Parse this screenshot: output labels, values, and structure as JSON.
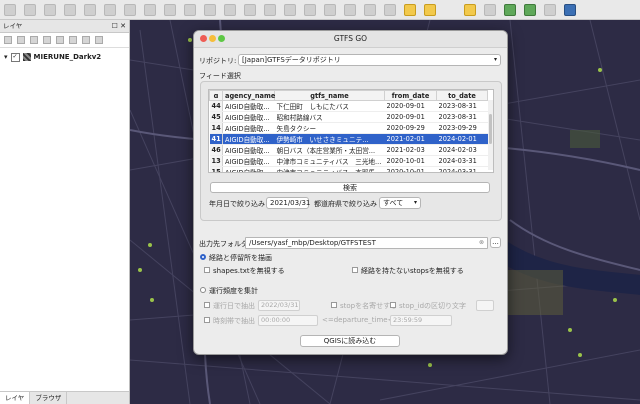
{
  "layers_panel": {
    "title": "レイヤ",
    "layer_name": "MIERUNE_Darkv2",
    "layer_checked": "✓",
    "tabs": [
      "レイヤ",
      "ブラウザ"
    ]
  },
  "dialog": {
    "title": "GTFS GO",
    "repo_label": "リポジトリ:",
    "repo_value": "[Japan]GTFSデータリポジトリ",
    "feed_group_label": "フィード選択",
    "columns": [
      "agency_name",
      "gtfs_name",
      "from_date",
      "to_date"
    ],
    "rows": [
      {
        "id": "44",
        "agency": "AIGID自動取...",
        "gtfs": "下仁田町　しもにたバス",
        "from": "2020-09-01",
        "to": "2023-08-31"
      },
      {
        "id": "45",
        "agency": "AIGID自動取...",
        "gtfs": "昭和村路線バス",
        "from": "2020-09-01",
        "to": "2023-08-31"
      },
      {
        "id": "14",
        "agency": "AIGID自動取...",
        "gtfs": "矢島タクシー",
        "from": "2020-09-29",
        "to": "2023-09-29"
      },
      {
        "id": "41",
        "agency": "AIGID自動取...",
        "gtfs": "伊勢崎市　いせさきミュニテ...",
        "from": "2021-02-01",
        "to": "2024-02-01"
      },
      {
        "id": "46",
        "agency": "AIGID自動取...",
        "gtfs": "朝日バス（本庄営業所・太田営...",
        "from": "2021-02-03",
        "to": "2024-02-03"
      },
      {
        "id": "13",
        "agency": "AIGID自動取...",
        "gtfs": "中津市コミュニティバス　三光地...",
        "from": "2020-10-01",
        "to": "2024-03-31"
      },
      {
        "id": "15",
        "agency": "AIGID自動取...",
        "gtfs": "中津市コミュニティバス　本耶馬...",
        "from": "2020-10-01",
        "to": "2024-03-31"
      }
    ],
    "selected_row": 3,
    "search_button": "検索",
    "year_filter_label": "年月日で絞り込み",
    "year_filter_value": "2021/03/31",
    "pref_filter_label": "都道府県で絞り込み",
    "pref_filter_value": "すべて",
    "output_label": "出力先フォルダ",
    "output_path": "/Users/yasf_mbp/Desktop/GTFSTEST",
    "browse_button": "...",
    "route_radio_label": "経路と停留所を描画",
    "ignore_shapes_label": "shapes.txtを無視する",
    "no_route_stops_label": "経路を持たないstopsを無視する",
    "freq_radio_label": "運行頻度を集計",
    "date_check_label": "運行日で抽出",
    "date_value": "2022/03/31",
    "stop_name_label": "stopを名寄せする",
    "stop_id_label": "stop_idの区切り文字",
    "time_check_label": "時刻帯で抽出",
    "time_start": "00:00:00",
    "departure_time_label": "<=departure_time<",
    "time_end": "23:59:59",
    "load_button": "QGISに読み込む"
  }
}
